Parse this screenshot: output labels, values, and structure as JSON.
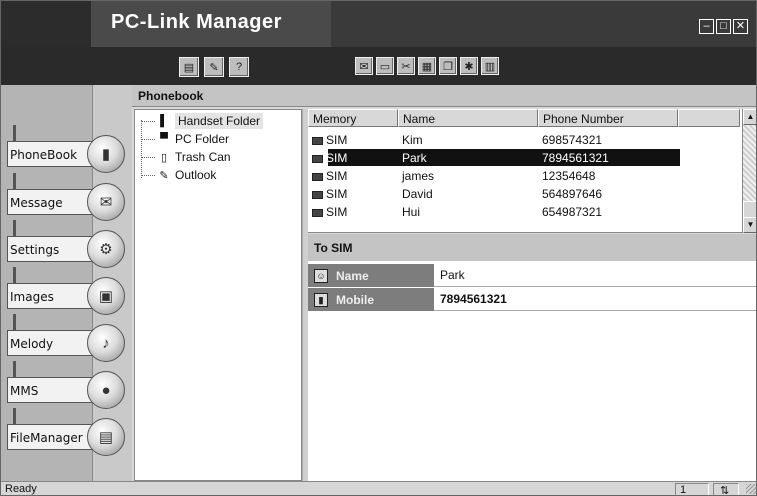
{
  "window": {
    "title": "PC-Link Manager",
    "controls": [
      "minimize",
      "maximize",
      "close"
    ]
  },
  "toolbar": {
    "left_icons": [
      "document-icon",
      "edit-icon",
      "help-icon"
    ],
    "right_icons": [
      "mail-icon",
      "folder-icon",
      "tool-icon",
      "grid-icon",
      "copy-icon",
      "star-icon",
      "book-icon"
    ]
  },
  "nav": {
    "items": [
      {
        "label": "PhoneBook",
        "icon": "phone-icon",
        "glyph": "📱"
      },
      {
        "label": "Message",
        "icon": "envelope-icon",
        "glyph": "✉"
      },
      {
        "label": "Settings",
        "icon": "settings-icon",
        "glyph": "⚙"
      },
      {
        "label": "Images",
        "icon": "image-icon",
        "glyph": "▣"
      },
      {
        "label": "Melody",
        "icon": "music-icon",
        "glyph": "♪"
      },
      {
        "label": "MMS",
        "icon": "balloon-icon",
        "glyph": "●"
      },
      {
        "label": "FileManager",
        "icon": "printer-icon",
        "glyph": "▤"
      }
    ]
  },
  "phonebook": {
    "header": "Phonebook",
    "tree": [
      {
        "label": "Handset Folder",
        "icon": "handset-icon",
        "glyph": "▌",
        "selected": true
      },
      {
        "label": "PC Folder",
        "icon": "pc-icon",
        "glyph": "▀",
        "selected": false
      },
      {
        "label": "Trash Can",
        "icon": "trash-icon",
        "glyph": "▯",
        "selected": false
      },
      {
        "label": "Outlook",
        "icon": "outlook-icon",
        "glyph": "✎",
        "selected": false
      }
    ],
    "columns": [
      "Memory",
      "Name",
      "Phone Number"
    ],
    "rows": [
      {
        "memory": "SIM",
        "name": "Kim",
        "phone": "698574321",
        "selected": false
      },
      {
        "memory": "SIM",
        "name": "Park",
        "phone": "7894561321",
        "selected": true
      },
      {
        "memory": "SIM",
        "name": "james",
        "phone": "12354648",
        "selected": false
      },
      {
        "memory": "SIM",
        "name": "David",
        "phone": "564897646",
        "selected": false
      },
      {
        "memory": "SIM",
        "name": "Hui",
        "phone": "654987321",
        "selected": false
      }
    ]
  },
  "detail": {
    "header": "To SIM",
    "fields": [
      {
        "label": "Name",
        "value": "Park",
        "icon": "person-icon"
      },
      {
        "label": "Mobile",
        "value": "7894561321",
        "icon": "mobile-icon"
      }
    ]
  },
  "status": {
    "text": "Ready",
    "count": "1"
  },
  "colors": {
    "titlebar": "#3a3a3a",
    "toolbar": "#2a2a2a",
    "selection": "#111111",
    "detail_key_bg": "#7d7d7d"
  }
}
